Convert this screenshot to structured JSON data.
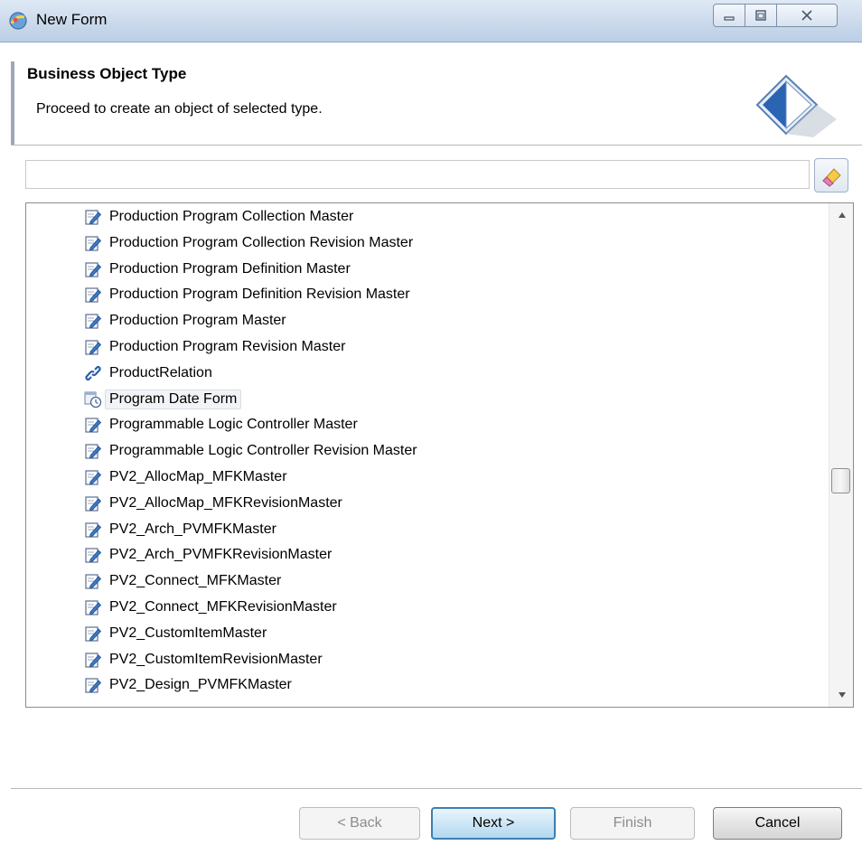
{
  "window": {
    "title": "New Form"
  },
  "header": {
    "title": "Business Object Type",
    "description": "Proceed to create an object of selected type."
  },
  "search": {
    "value": ""
  },
  "list": {
    "items": [
      {
        "label": "Production Program Collection Master",
        "icon": "form-edit-icon"
      },
      {
        "label": "Production Program Collection Revision Master",
        "icon": "form-edit-icon"
      },
      {
        "label": "Production Program Definition Master",
        "icon": "form-edit-icon"
      },
      {
        "label": "Production Program Definition Revision Master",
        "icon": "form-edit-icon"
      },
      {
        "label": "Production Program Master",
        "icon": "form-edit-icon"
      },
      {
        "label": "Production Program Revision Master",
        "icon": "form-edit-icon"
      },
      {
        "label": "ProductRelation",
        "icon": "relation-link-icon"
      },
      {
        "label": "Program Date Form",
        "icon": "date-form-icon",
        "selected": true
      },
      {
        "label": "Programmable Logic Controller Master",
        "icon": "form-edit-icon"
      },
      {
        "label": "Programmable Logic Controller Revision Master",
        "icon": "form-edit-icon"
      },
      {
        "label": "PV2_AllocMap_MFKMaster",
        "icon": "form-edit-icon"
      },
      {
        "label": "PV2_AllocMap_MFKRevisionMaster",
        "icon": "form-edit-icon"
      },
      {
        "label": "PV2_Arch_PVMFKMaster",
        "icon": "form-edit-icon"
      },
      {
        "label": "PV2_Arch_PVMFKRevisionMaster",
        "icon": "form-edit-icon"
      },
      {
        "label": "PV2_Connect_MFKMaster",
        "icon": "form-edit-icon"
      },
      {
        "label": "PV2_Connect_MFKRevisionMaster",
        "icon": "form-edit-icon"
      },
      {
        "label": "PV2_CustomItemMaster",
        "icon": "form-edit-icon"
      },
      {
        "label": "PV2_CustomItemRevisionMaster",
        "icon": "form-edit-icon"
      },
      {
        "label": "PV2_Design_PVMFKMaster",
        "icon": "form-edit-icon"
      }
    ]
  },
  "scroll": {
    "position_fraction": 0.56
  },
  "buttons": {
    "back": "< Back",
    "next": "Next >",
    "finish": "Finish",
    "cancel": "Cancel"
  },
  "colors": {
    "default_button": "#3c7fb1",
    "selection_bg": "#f1f3f6"
  }
}
